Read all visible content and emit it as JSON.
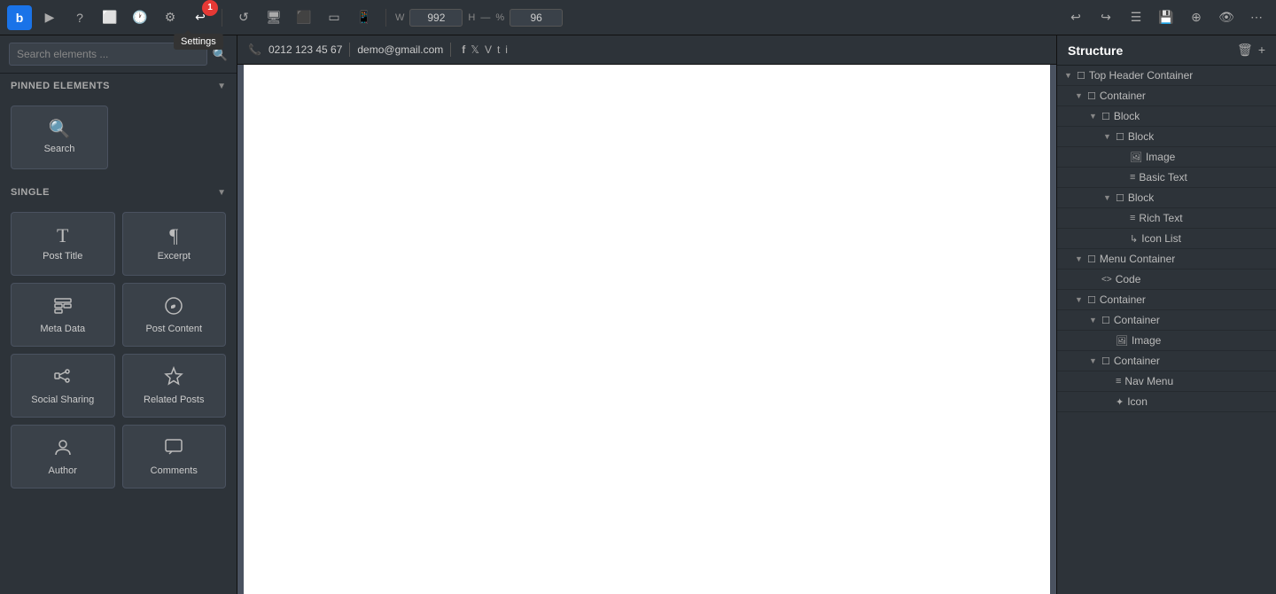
{
  "toolbar": {
    "logo_label": "b",
    "tooltip_settings": "Settings",
    "badge_number": "1",
    "w_label": "W",
    "w_value": "992",
    "h_label": "H",
    "percent_label": "%",
    "percent_value": "96"
  },
  "left_panel": {
    "search_placeholder": "Search elements ...",
    "pinned_section_title": "PINNED ELEMENTS",
    "pinned_elements": [
      {
        "id": "search",
        "label": "Search",
        "icon": "🔍"
      }
    ],
    "single_section_title": "SINGLE",
    "single_elements": [
      {
        "id": "post-title",
        "label": "Post Title",
        "icon": "T"
      },
      {
        "id": "excerpt",
        "label": "Excerpt",
        "icon": "¶"
      },
      {
        "id": "meta-data",
        "label": "Meta Data",
        "icon": "▦"
      },
      {
        "id": "post-content",
        "label": "Post Content",
        "icon": "W"
      },
      {
        "id": "social-sharing",
        "label": "Social Sharing",
        "icon": "↑"
      },
      {
        "id": "related-posts",
        "label": "Related Posts",
        "icon": "☆"
      },
      {
        "id": "author",
        "label": "Author",
        "icon": "👤"
      },
      {
        "id": "comments",
        "label": "Comments",
        "icon": "💬"
      }
    ]
  },
  "canvas": {
    "phone_icon": "📞",
    "phone_number": "0212 123 45 67",
    "email": "demo@gmail.com",
    "social_icons": [
      "f",
      "𝕏",
      "V",
      "t",
      "i"
    ]
  },
  "right_panel": {
    "title": "Structure",
    "tree_items": [
      {
        "level": 0,
        "label": "Top Header Container",
        "icon": "☐",
        "has_chevron": true,
        "chevron_dir": "down"
      },
      {
        "level": 1,
        "label": "Container",
        "icon": "☐",
        "has_chevron": true,
        "chevron_dir": "down"
      },
      {
        "level": 2,
        "label": "Block",
        "icon": "☐",
        "has_chevron": true,
        "chevron_dir": "down"
      },
      {
        "level": 3,
        "label": "Block",
        "icon": "☐",
        "has_chevron": true,
        "chevron_dir": "down"
      },
      {
        "level": 4,
        "label": "Image",
        "icon": "🖼",
        "has_chevron": false
      },
      {
        "level": 4,
        "label": "Basic Text",
        "icon": "≡",
        "has_chevron": false
      },
      {
        "level": 3,
        "label": "Block",
        "icon": "☐",
        "has_chevron": true,
        "chevron_dir": "down"
      },
      {
        "level": 4,
        "label": "Rich Text",
        "icon": "≡",
        "has_chevron": false
      },
      {
        "level": 4,
        "label": "Icon List",
        "icon": "↳",
        "has_chevron": false
      },
      {
        "level": 1,
        "label": "Menu Container",
        "icon": "☐",
        "has_chevron": true,
        "chevron_dir": "down"
      },
      {
        "level": 2,
        "label": "Code",
        "icon": "<>",
        "has_chevron": false
      },
      {
        "level": 1,
        "label": "Container",
        "icon": "☐",
        "has_chevron": true,
        "chevron_dir": "down"
      },
      {
        "level": 2,
        "label": "Container",
        "icon": "☐",
        "has_chevron": true,
        "chevron_dir": "down"
      },
      {
        "level": 3,
        "label": "Image",
        "icon": "🖼",
        "has_chevron": false
      },
      {
        "level": 2,
        "label": "Container",
        "icon": "☐",
        "has_chevron": true,
        "chevron_dir": "down"
      },
      {
        "level": 3,
        "label": "Nav Menu",
        "icon": "≡",
        "has_chevron": false
      },
      {
        "level": 3,
        "label": "Icon",
        "icon": "✦",
        "has_chevron": false
      }
    ]
  }
}
